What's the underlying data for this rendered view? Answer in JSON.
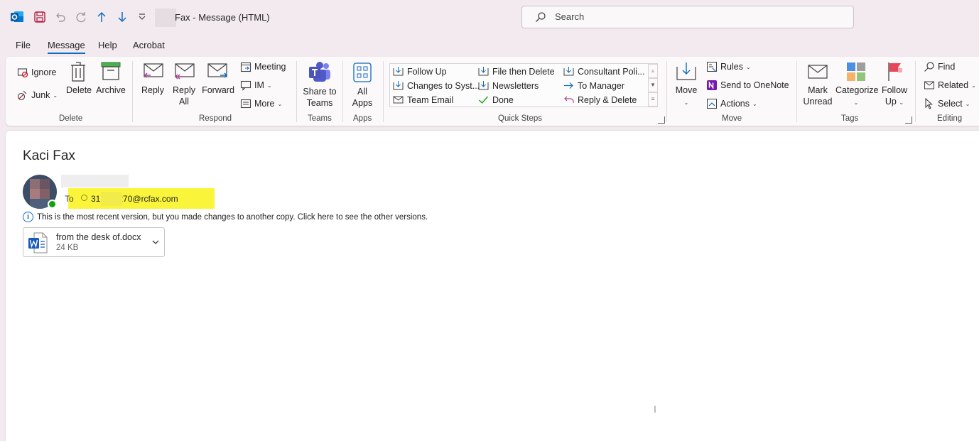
{
  "window": {
    "title": "Fax  -  Message (HTML)"
  },
  "search": {
    "placeholder": "Search"
  },
  "menu": {
    "tabs": [
      "File",
      "Message",
      "Help",
      "Acrobat"
    ],
    "active": "Message"
  },
  "ribbon": {
    "delete_group": {
      "label": "Delete",
      "ignore": "Ignore",
      "junk": "Junk",
      "delete": "Delete",
      "archive": "Archive"
    },
    "respond_group": {
      "label": "Respond",
      "reply": "Reply",
      "reply_all_1": "Reply",
      "reply_all_2": "All",
      "forward": "Forward",
      "meeting": "Meeting",
      "im": "IM",
      "more": "More"
    },
    "teams_group": {
      "label": "Teams",
      "share_1": "Share to",
      "share_2": "Teams"
    },
    "apps_group": {
      "label": "Apps",
      "all_1": "All",
      "all_2": "Apps"
    },
    "quick_steps": {
      "label": "Quick Steps",
      "items": [
        "Follow Up",
        "File then Delete",
        "Consultant Poli...",
        "Changes to Syst...",
        "Newsletters",
        "To Manager",
        "Team Email",
        "Done",
        "Reply & Delete"
      ]
    },
    "move_group": {
      "label": "Move",
      "move": "Move",
      "rules": "Rules",
      "onenote": "Send to OneNote",
      "actions": "Actions"
    },
    "tags_group": {
      "label": "Tags",
      "mark_1": "Mark",
      "mark_2": "Unread",
      "categorize": "Categorize",
      "follow_1": "Follow",
      "follow_2": "Up"
    },
    "editing_group": {
      "label": "Editing",
      "find": "Find",
      "related": "Related",
      "select": "Select"
    }
  },
  "message": {
    "subject": "Kaci Fax",
    "to_label": "To",
    "to_address_prefix": "31",
    "to_address_suffix": "270@rcfax.com",
    "info_text": "This is the most recent version, but you made changes to another copy. Click here to see the other versions.",
    "attachment": {
      "name": "from the desk of.docx",
      "size": "24 KB"
    }
  },
  "colors": {
    "accent": "#0f6cbd",
    "highlight": "#faf53a",
    "background": "#f3eaef"
  }
}
